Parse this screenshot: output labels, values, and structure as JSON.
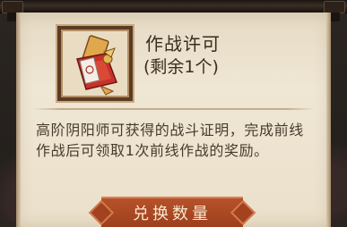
{
  "item": {
    "name": "作战许可",
    "count": "(剩余1个)",
    "icon": "battle-permit-scroll-icon"
  },
  "description": "高阶阴阳师可获得的战斗证明，完成前线作战后可领取1次前线作战的奖励。",
  "actions": {
    "exchange_label": "兑换数量"
  },
  "colors": {
    "panel": "#efe6d4",
    "text": "#3b2c20",
    "button": "#b6522a",
    "frame": "#5b3b25"
  }
}
